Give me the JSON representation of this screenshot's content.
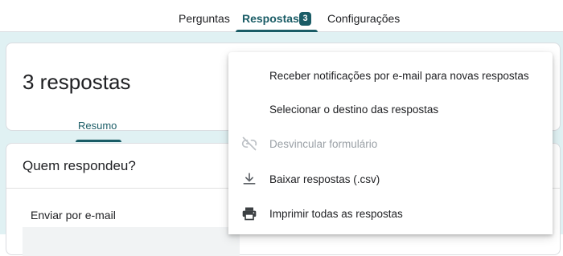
{
  "nav": {
    "tabs": [
      {
        "label": "Perguntas"
      },
      {
        "label": "Respostas",
        "badge": "3"
      },
      {
        "label": "Configurações"
      }
    ]
  },
  "summary": {
    "count_text": "3 respostas",
    "tab_label": "Resumo"
  },
  "respondents": {
    "title": "Quem respondeu?",
    "field_label": "Enviar por e-mail"
  },
  "menu": {
    "items": [
      {
        "label": "Receber notificações por e-mail para novas respostas"
      },
      {
        "label": "Selecionar o destino das respostas"
      },
      {
        "label": "Desvincular formulário",
        "icon": "link-off-icon",
        "disabled": true
      },
      {
        "label": "Baixar respostas (.csv)",
        "icon": "download-icon"
      },
      {
        "label": "Imprimir todas as respostas",
        "icon": "print-icon"
      }
    ]
  },
  "colors": {
    "accent": "#1a5c66",
    "background": "#e0f1f3",
    "disabled_text": "#9aa0a6"
  }
}
